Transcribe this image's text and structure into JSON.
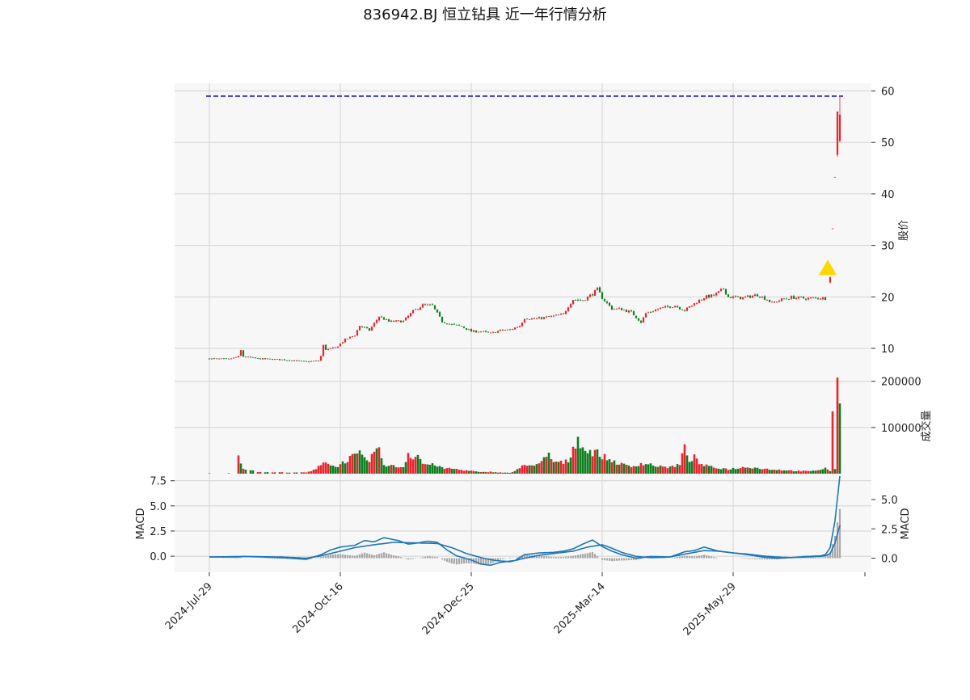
{
  "colors": {
    "up": "#e8242f",
    "down": "#0d7f1f",
    "panel_bg": "#f7f7f7",
    "grid": "#d3d3d3",
    "macd_line": "#1f77b4",
    "signal_line": "#1f77b4",
    "histogram": "#a9a9a9",
    "dashed_line": "#1616d9",
    "marker": "#ffd700"
  },
  "chart_data": {
    "type": "candlestick",
    "title": "836942.BJ 恒立钻具 近一年行情分析",
    "x": {
      "tick_labels": [
        "2024-Jul-29",
        "2024-Oct-16",
        "2024-Dec-25",
        "2025-Mar-14",
        "2025-May-29"
      ],
      "tick_index": [
        0,
        54,
        108,
        162,
        216
      ],
      "total_points": 270
    },
    "price_panel": {
      "ylabel": "股价",
      "ylim": [
        4.5,
        61.5
      ],
      "ticks": [
        10,
        20,
        30,
        40,
        50,
        60
      ],
      "reference_line": {
        "value": 59,
        "style": "dashed"
      },
      "marker": {
        "index": 255,
        "value": 25.5,
        "shape": "triangle-up"
      },
      "anchors": [
        [
          0,
          8.0
        ],
        [
          8,
          7.9
        ],
        [
          12,
          8.4
        ],
        [
          13,
          9.6
        ],
        [
          14,
          8.4
        ],
        [
          20,
          8.0
        ],
        [
          30,
          7.8
        ],
        [
          40,
          7.4
        ],
        [
          45,
          7.6
        ],
        [
          46,
          8.5
        ],
        [
          47,
          10.6
        ],
        [
          48,
          9.8
        ],
        [
          52,
          10.1
        ],
        [
          56,
          11.7
        ],
        [
          60,
          12.6
        ],
        [
          62,
          14.4
        ],
        [
          66,
          13.5
        ],
        [
          70,
          16.2
        ],
        [
          74,
          15.2
        ],
        [
          80,
          15.3
        ],
        [
          84,
          17.2
        ],
        [
          88,
          18.4
        ],
        [
          92,
          18.3
        ],
        [
          96,
          15.2
        ],
        [
          100,
          14.6
        ],
        [
          104,
          14.3
        ],
        [
          108,
          13.3
        ],
        [
          112,
          13.3
        ],
        [
          116,
          12.9
        ],
        [
          120,
          13.5
        ],
        [
          124,
          13.6
        ],
        [
          128,
          14.4
        ],
        [
          130,
          15.9
        ],
        [
          134,
          15.7
        ],
        [
          140,
          16.1
        ],
        [
          146,
          16.6
        ],
        [
          148,
          18.2
        ],
        [
          150,
          19.5
        ],
        [
          154,
          19.3
        ],
        [
          158,
          20.6
        ],
        [
          160,
          21.5
        ],
        [
          162,
          19.8
        ],
        [
          166,
          17.7
        ],
        [
          170,
          17.6
        ],
        [
          174,
          17.0
        ],
        [
          178,
          15.1
        ],
        [
          180,
          16.8
        ],
        [
          186,
          17.8
        ],
        [
          192,
          18.3
        ],
        [
          196,
          17.4
        ],
        [
          200,
          18.7
        ],
        [
          204,
          19.9
        ],
        [
          208,
          20.3
        ],
        [
          210,
          20.9
        ],
        [
          212,
          21.6
        ],
        [
          214,
          20.0
        ],
        [
          220,
          19.8
        ],
        [
          226,
          20.4
        ],
        [
          230,
          19.5
        ],
        [
          232,
          18.8
        ],
        [
          236,
          19.5
        ],
        [
          240,
          19.9
        ],
        [
          246,
          19.7
        ],
        [
          252,
          19.8
        ],
        [
          254,
          19.7
        ]
      ],
      "spike_candles": [
        {
          "index": 256,
          "open": 22.8,
          "high": 24.0,
          "low": 22.6,
          "close": 23.8
        },
        {
          "index": 257,
          "open": 33.3,
          "high": 33.3,
          "low": 33.3,
          "close": 33.3
        },
        {
          "index": 258,
          "open": 43.3,
          "high": 43.3,
          "low": 43.3,
          "close": 43.3
        },
        {
          "index": 259,
          "open": 47.6,
          "high": 56.0,
          "low": 47.2,
          "close": 56.0
        },
        {
          "index": 260,
          "open": 50.3,
          "high": 59.0,
          "low": 50.0,
          "close": 55.4
        }
      ]
    },
    "volume_panel": {
      "ylabel": "成交量",
      "ylim": [
        0,
        210000
      ],
      "ticks": [
        100000,
        200000
      ],
      "tick_labels": [
        "100000",
        "200000"
      ],
      "anchors": [
        [
          0,
          900
        ],
        [
          8,
          1200
        ],
        [
          11,
          500
        ],
        [
          12,
          38000
        ],
        [
          13,
          27000
        ],
        [
          14,
          12000
        ],
        [
          17,
          7000
        ],
        [
          20,
          4000
        ],
        [
          24,
          3000
        ],
        [
          40,
          2500
        ],
        [
          44,
          9000
        ],
        [
          46,
          22000
        ],
        [
          48,
          28000
        ],
        [
          50,
          18000
        ],
        [
          52,
          15000
        ],
        [
          54,
          20000
        ],
        [
          58,
          34000
        ],
        [
          60,
          38000
        ],
        [
          62,
          42000
        ],
        [
          64,
          30000
        ],
        [
          66,
          28000
        ],
        [
          68,
          50000
        ],
        [
          70,
          48000
        ],
        [
          72,
          20000
        ],
        [
          76,
          16000
        ],
        [
          80,
          14000
        ],
        [
          82,
          45000
        ],
        [
          84,
          36000
        ],
        [
          86,
          40000
        ],
        [
          88,
          22000
        ],
        [
          90,
          20000
        ],
        [
          94,
          18000
        ],
        [
          96,
          12000
        ],
        [
          100,
          11000
        ],
        [
          104,
          8000
        ],
        [
          108,
          6000
        ],
        [
          112,
          3000
        ],
        [
          116,
          4000
        ],
        [
          120,
          2500
        ],
        [
          124,
          2000
        ],
        [
          126,
          5000
        ],
        [
          128,
          12000
        ],
        [
          130,
          22000
        ],
        [
          134,
          16000
        ],
        [
          136,
          20000
        ],
        [
          140,
          42000
        ],
        [
          142,
          25000
        ],
        [
          146,
          24000
        ],
        [
          148,
          28000
        ],
        [
          152,
          80000
        ],
        [
          154,
          55000
        ],
        [
          156,
          48000
        ],
        [
          158,
          47000
        ],
        [
          160,
          45000
        ],
        [
          162,
          38000
        ],
        [
          166,
          28000
        ],
        [
          170,
          20000
        ],
        [
          174,
          15000
        ],
        [
          178,
          22000
        ],
        [
          182,
          20000
        ],
        [
          186,
          15000
        ],
        [
          190,
          14000
        ],
        [
          194,
          20000
        ],
        [
          196,
          55000
        ],
        [
          198,
          30000
        ],
        [
          200,
          35000
        ],
        [
          202,
          22000
        ],
        [
          206,
          15000
        ],
        [
          210,
          12000
        ],
        [
          214,
          10000
        ],
        [
          218,
          12000
        ],
        [
          222,
          15000
        ],
        [
          226,
          12000
        ],
        [
          230,
          10000
        ],
        [
          236,
          8000
        ],
        [
          242,
          6000
        ],
        [
          248,
          5000
        ],
        [
          252,
          9000
        ],
        [
          254,
          12000
        ],
        [
          256,
          6000
        ]
      ],
      "spike_bars": [
        {
          "index": 257,
          "value": 135000
        },
        {
          "index": 258,
          "value": 10000
        },
        {
          "index": 259,
          "value": 208000
        },
        {
          "index": 260,
          "value": 152000
        }
      ]
    },
    "macd_panel": {
      "ylabel_left": "MACD",
      "ylabel_right": "MACD",
      "left_ylim": [
        -1.6,
        8.2
      ],
      "left_ticks": [
        0.0,
        2.5,
        5.0,
        7.5
      ],
      "left_tick_labels": [
        "0.0",
        "2.5",
        "5.0",
        "7.5"
      ],
      "right_ylim": [
        -1.2,
        7.2
      ],
      "right_ticks": [
        0.0,
        2.5,
        5.0
      ],
      "right_tick_labels": [
        "0.0",
        "2.5",
        "5.0"
      ],
      "macd_anchors": [
        [
          0,
          0.1
        ],
        [
          12,
          0.1
        ],
        [
          14,
          0.15
        ],
        [
          30,
          0.05
        ],
        [
          40,
          -0.1
        ],
        [
          46,
          0.3
        ],
        [
          50,
          0.7
        ],
        [
          54,
          0.95
        ],
        [
          60,
          1.1
        ],
        [
          64,
          1.5
        ],
        [
          68,
          1.4
        ],
        [
          72,
          1.75
        ],
        [
          78,
          1.5
        ],
        [
          82,
          1.2
        ],
        [
          86,
          1.3
        ],
        [
          90,
          1.45
        ],
        [
          94,
          1.35
        ],
        [
          98,
          0.7
        ],
        [
          102,
          0.2
        ],
        [
          108,
          -0.15
        ],
        [
          112,
          -0.5
        ],
        [
          116,
          -0.6
        ],
        [
          120,
          -0.35
        ],
        [
          126,
          -0.2
        ],
        [
          130,
          0.3
        ],
        [
          136,
          0.45
        ],
        [
          142,
          0.5
        ],
        [
          146,
          0.6
        ],
        [
          150,
          0.8
        ],
        [
          154,
          1.2
        ],
        [
          158,
          1.55
        ],
        [
          162,
          1.0
        ],
        [
          166,
          0.6
        ],
        [
          170,
          0.3
        ],
        [
          176,
          0.0
        ],
        [
          182,
          0.15
        ],
        [
          190,
          0.1
        ],
        [
          196,
          0.55
        ],
        [
          200,
          0.65
        ],
        [
          204,
          0.95
        ],
        [
          210,
          0.6
        ],
        [
          216,
          0.45
        ],
        [
          222,
          0.3
        ],
        [
          228,
          0.1
        ],
        [
          234,
          0.0
        ],
        [
          240,
          0.05
        ],
        [
          246,
          0.15
        ],
        [
          252,
          0.2
        ],
        [
          254,
          0.3
        ],
        [
          256,
          0.9
        ],
        [
          258,
          3.2
        ],
        [
          260,
          7.0
        ]
      ],
      "signal_anchors": [
        [
          0,
          0.1
        ],
        [
          14,
          0.15
        ],
        [
          30,
          0.1
        ],
        [
          40,
          0.0
        ],
        [
          46,
          0.2
        ],
        [
          54,
          0.6
        ],
        [
          60,
          0.9
        ],
        [
          68,
          1.15
        ],
        [
          76,
          1.35
        ],
        [
          86,
          1.3
        ],
        [
          94,
          1.25
        ],
        [
          100,
          0.9
        ],
        [
          106,
          0.4
        ],
        [
          112,
          0.05
        ],
        [
          118,
          -0.2
        ],
        [
          124,
          -0.3
        ],
        [
          130,
          0.0
        ],
        [
          136,
          0.25
        ],
        [
          144,
          0.45
        ],
        [
          150,
          0.6
        ],
        [
          156,
          0.95
        ],
        [
          162,
          1.15
        ],
        [
          166,
          0.85
        ],
        [
          170,
          0.5
        ],
        [
          176,
          0.15
        ],
        [
          182,
          0.05
        ],
        [
          190,
          0.1
        ],
        [
          196,
          0.35
        ],
        [
          204,
          0.65
        ],
        [
          210,
          0.6
        ],
        [
          216,
          0.45
        ],
        [
          222,
          0.35
        ],
        [
          228,
          0.2
        ],
        [
          234,
          0.1
        ],
        [
          240,
          0.05
        ],
        [
          246,
          0.1
        ],
        [
          252,
          0.15
        ],
        [
          254,
          0.2
        ],
        [
          256,
          0.4
        ],
        [
          258,
          1.3
        ],
        [
          260,
          2.8
        ]
      ]
    }
  }
}
